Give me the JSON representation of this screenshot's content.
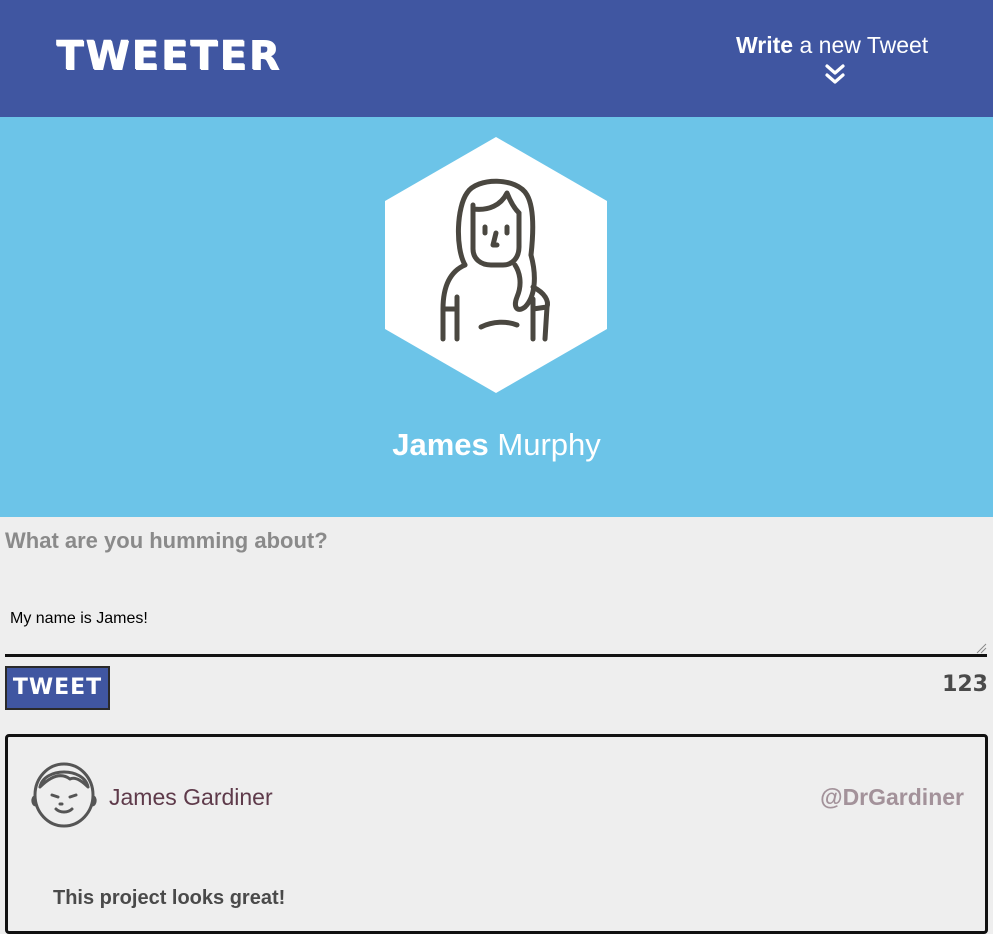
{
  "nav": {
    "logo": "TWEETER",
    "compose_toggle_strong": "Write",
    "compose_toggle_rest": " a new Tweet",
    "chevron_icon": "double-chevron-down-icon"
  },
  "profile": {
    "avatar_icon": "woman-avatar-icon",
    "first_name": "James",
    "last_name": "Murphy"
  },
  "compose": {
    "label": "What are you humming about?",
    "value": "My name is James!",
    "button_label": "TWEET",
    "counter": "123"
  },
  "tweets": [
    {
      "avatar_icon": "man-avatar-icon",
      "name": "James Gardiner",
      "handle": "@DrGardiner",
      "content": "This project looks great!"
    }
  ],
  "colors": {
    "nav_bg": "#4056a1",
    "header_bg": "#6cc4e8",
    "page_bg": "#eeeeee"
  }
}
